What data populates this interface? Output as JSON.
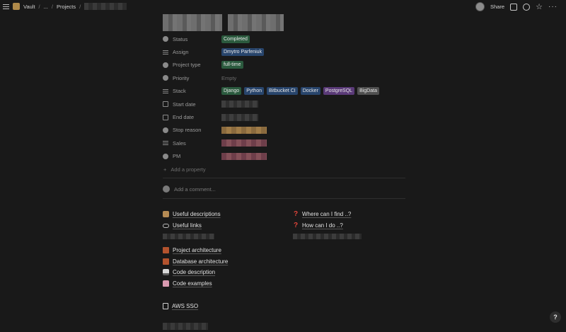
{
  "topbar": {
    "breadcrumbs": [
      "Vault",
      "...",
      "Projects"
    ],
    "share_label": "Share",
    "icons": [
      "menu-icon",
      "vault-icon",
      "avatar",
      "comment-icon",
      "history-icon",
      "star-icon",
      "more-icon"
    ]
  },
  "properties": [
    {
      "name": "Status",
      "icon": "status-icon",
      "tags": [
        {
          "text": "Completed",
          "color": "green"
        }
      ]
    },
    {
      "name": "Assign",
      "icon": "list-icon",
      "tags": [
        {
          "text": "Dmytro Parfeniuk",
          "color": "blue"
        }
      ]
    },
    {
      "name": "Project type",
      "icon": "status-icon",
      "tags": [
        {
          "text": "full-time",
          "color": "green"
        }
      ]
    },
    {
      "name": "Priority",
      "icon": "status-icon",
      "empty": "Empty"
    },
    {
      "name": "Stack",
      "icon": "list-icon",
      "tags": [
        {
          "text": "Django",
          "color": "green"
        },
        {
          "text": "Python",
          "color": "blue"
        },
        {
          "text": "Bitbucket CI",
          "color": "blue"
        },
        {
          "text": "Docker",
          "color": "blue"
        },
        {
          "text": "PostgreSQL",
          "color": "purple"
        },
        {
          "text": "BigData",
          "color": "gray"
        }
      ]
    },
    {
      "name": "Start date",
      "icon": "calendar-icon"
    },
    {
      "name": "End date",
      "icon": "calendar-icon"
    },
    {
      "name": "Stop reason",
      "icon": "status-icon"
    },
    {
      "name": "Sales",
      "icon": "list-icon"
    },
    {
      "name": "PM",
      "icon": "status-icon"
    }
  ],
  "add_property_label": "Add a property",
  "comment_placeholder": "Add a comment...",
  "links_left": [
    {
      "label": "Useful descriptions",
      "icon": "book-icon"
    },
    {
      "label": "Useful links",
      "icon": "link-icon"
    }
  ],
  "links_right": [
    {
      "label": "Where can I find ..?",
      "icon": "question-icon"
    },
    {
      "label": "How can I do ..?",
      "icon": "question-icon"
    }
  ],
  "links_architecture": [
    {
      "label": "Project architecture",
      "icon": "brick-icon"
    },
    {
      "label": "Database architecture",
      "icon": "brick-icon"
    },
    {
      "label": "Code description",
      "icon": "computer-icon"
    },
    {
      "label": "Code examples",
      "icon": "cake-icon"
    }
  ],
  "aws_link": {
    "label": "AWS SSO",
    "icon": "page-icon"
  },
  "help_label": "?"
}
